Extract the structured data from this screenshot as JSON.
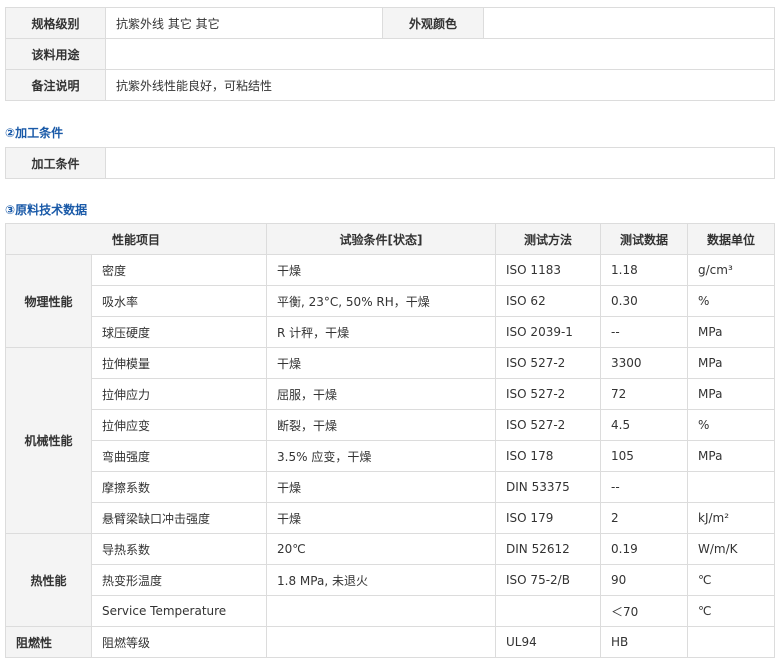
{
  "info": {
    "spec_label": "规格级别",
    "spec_value": "抗紫外线 其它 其它",
    "color_label": "外观颜色",
    "color_value": "",
    "use_label": "该料用途",
    "use_value": "",
    "note_label": "备注说明",
    "note_value": "抗紫外线性能良好，可粘结性"
  },
  "processing": {
    "heading": "②加工条件",
    "label": "加工条件",
    "value": ""
  },
  "tech": {
    "heading": "③原料技术数据",
    "headers": [
      "性能项目",
      "试验条件[状态]",
      "测试方法",
      "测试数据",
      "数据单位"
    ],
    "groups": [
      {
        "name": "物理性能",
        "rows": [
          {
            "item": "密度",
            "cond": "干燥",
            "method": "ISO 1183",
            "value": "1.18",
            "unit": "g/cm³"
          },
          {
            "item": "吸水率",
            "cond": "平衡, 23°C, 50% RH，干燥",
            "method": "ISO 62",
            "value": "0.30",
            "unit": "%"
          },
          {
            "item": "球压硬度",
            "cond": "R 计秤，干燥",
            "method": "ISO 2039-1",
            "value": "--",
            "unit": "MPa"
          }
        ]
      },
      {
        "name": "机械性能",
        "rows": [
          {
            "item": "拉伸模量",
            "cond": "干燥",
            "method": "ISO 527-2",
            "value": "3300",
            "unit": "MPa"
          },
          {
            "item": "拉伸应力",
            "cond": "屈服，干燥",
            "method": "ISO 527-2",
            "value": "72",
            "unit": "MPa"
          },
          {
            "item": "拉伸应变",
            "cond": "断裂，干燥",
            "method": "ISO 527-2",
            "value": "4.5",
            "unit": "%"
          },
          {
            "item": "弯曲强度",
            "cond": "3.5% 应变，干燥",
            "method": "ISO 178",
            "value": "105",
            "unit": "MPa"
          },
          {
            "item": "摩擦系数",
            "cond": "干燥",
            "method": "DIN 53375",
            "value": "--",
            "unit": ""
          },
          {
            "item": "悬臂梁缺口冲击强度",
            "cond": "干燥",
            "method": "ISO 179",
            "value": "2",
            "unit": "kJ/m²"
          }
        ]
      },
      {
        "name": "热性能",
        "rows": [
          {
            "item": "导热系数",
            "cond": "20℃",
            "method": "DIN 52612",
            "value": "0.19",
            "unit": "W/m/K"
          },
          {
            "item": "热变形温度",
            "cond": "1.8 MPa, 未退火",
            "method": "ISO 75-2/B",
            "value": "90",
            "unit": "℃"
          },
          {
            "item": "Service Temperature",
            "cond": "",
            "method": "",
            "value": "＜70",
            "unit": "℃"
          }
        ]
      },
      {
        "name": "阻燃性",
        "rows": [
          {
            "item": "阻燃等级",
            "cond": "",
            "method": "UL94",
            "value": "HB",
            "unit": ""
          }
        ]
      }
    ]
  }
}
